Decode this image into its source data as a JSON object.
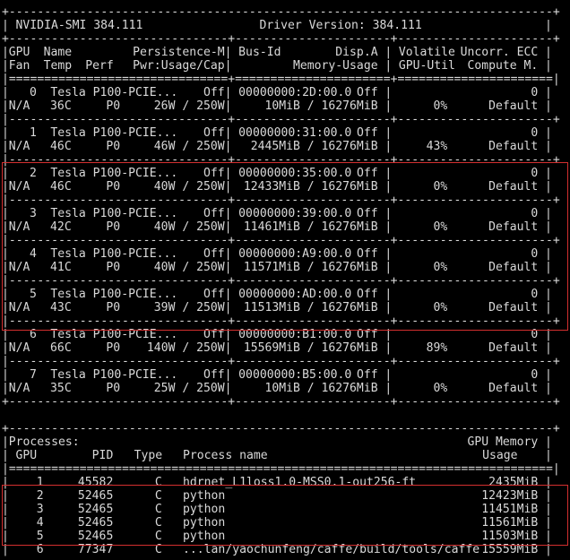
{
  "header": {
    "title": "NVIDIA-SMI 384.111",
    "driver_version": "Driver Version: 384.111"
  },
  "rules": {
    "dash_full": "+-----------------------------------------------------------------------------+",
    "dash_gpu": "+-------------------------------+----------------------+----------------------+",
    "double_gpu": "|===============================+======================+======================|",
    "double_full": "|=============================================================================|",
    "mid_gap": "|-------------------------------+----------------------+----------------------+"
  },
  "gpu_columns": {
    "r1": {
      "gpu": "GPU",
      "name": "Name",
      "persistence": "Persistence-M",
      "bus_id": "Bus-Id",
      "disp_a": "Disp.A",
      "volatile": "Volatile",
      "ecc": "Uncorr. ECC"
    },
    "r2": {
      "fan": "Fan",
      "temp": "Temp",
      "perf": "Perf",
      "pwr": "Pwr:Usage/Cap",
      "memory_usage": "Memory-Usage",
      "gpu_util": "GPU-Util",
      "compute": "Compute M."
    }
  },
  "gpus": [
    {
      "index": "0",
      "name": "Tesla P100-PCIE...",
      "persistence": "Off",
      "bus_id": "00000000:2D:00.0",
      "disp": "Off",
      "ecc": "0",
      "fan": "N/A",
      "temp": "36C",
      "perf": "P0",
      "power": "26W / 250W",
      "memory": "10MiB / 16276MiB",
      "util": "0%",
      "compute": "Default"
    },
    {
      "index": "1",
      "name": "Tesla P100-PCIE...",
      "persistence": "Off",
      "bus_id": "00000000:31:00.0",
      "disp": "Off",
      "ecc": "0",
      "fan": "N/A",
      "temp": "46C",
      "perf": "P0",
      "power": "46W / 250W",
      "memory": "2445MiB / 16276MiB",
      "util": "43%",
      "compute": "Default"
    },
    {
      "index": "2",
      "name": "Tesla P100-PCIE...",
      "persistence": "Off",
      "bus_id": "00000000:35:00.0",
      "disp": "Off",
      "ecc": "0",
      "fan": "N/A",
      "temp": "46C",
      "perf": "P0",
      "power": "40W / 250W",
      "memory": "12433MiB / 16276MiB",
      "util": "0%",
      "compute": "Default"
    },
    {
      "index": "3",
      "name": "Tesla P100-PCIE...",
      "persistence": "Off",
      "bus_id": "00000000:39:00.0",
      "disp": "Off",
      "ecc": "0",
      "fan": "N/A",
      "temp": "42C",
      "perf": "P0",
      "power": "40W / 250W",
      "memory": "11461MiB / 16276MiB",
      "util": "0%",
      "compute": "Default"
    },
    {
      "index": "4",
      "name": "Tesla P100-PCIE...",
      "persistence": "Off",
      "bus_id": "00000000:A9:00.0",
      "disp": "Off",
      "ecc": "0",
      "fan": "N/A",
      "temp": "41C",
      "perf": "P0",
      "power": "40W / 250W",
      "memory": "11571MiB / 16276MiB",
      "util": "0%",
      "compute": "Default"
    },
    {
      "index": "5",
      "name": "Tesla P100-PCIE...",
      "persistence": "Off",
      "bus_id": "00000000:AD:00.0",
      "disp": "Off",
      "ecc": "0",
      "fan": "N/A",
      "temp": "43C",
      "perf": "P0",
      "power": "39W / 250W",
      "memory": "11513MiB / 16276MiB",
      "util": "0%",
      "compute": "Default"
    },
    {
      "index": "6",
      "name": "Tesla P100-PCIE...",
      "persistence": "Off",
      "bus_id": "00000000:B1:00.0",
      "disp": "Off",
      "ecc": "0",
      "fan": "N/A",
      "temp": "66C",
      "perf": "P0",
      "power": "140W / 250W",
      "memory": "15569MiB / 16276MiB",
      "util": "89%",
      "compute": "Default"
    },
    {
      "index": "7",
      "name": "Tesla P100-PCIE...",
      "persistence": "Off",
      "bus_id": "00000000:B5:00.0",
      "disp": "Off",
      "ecc": "0",
      "fan": "N/A",
      "temp": "35C",
      "perf": "P0",
      "power": "25W / 250W",
      "memory": "10MiB / 16276MiB",
      "util": "0%",
      "compute": "Default"
    }
  ],
  "processes": {
    "heading": "Processes:",
    "gpu_memory_1": "GPU Memory",
    "columns": {
      "gpu": "GPU",
      "pid": "PID",
      "type": "Type",
      "name": "Process name",
      "usage": "Usage"
    },
    "rows": [
      {
        "gpu": "1",
        "pid": "45582",
        "type": "C",
        "name": "hdrnet_L1loss1.0-MSS0.1-out256-ft",
        "memory": "2435MiB"
      },
      {
        "gpu": "2",
        "pid": "52465",
        "type": "C",
        "name": "python",
        "memory": "12423MiB"
      },
      {
        "gpu": "3",
        "pid": "52465",
        "type": "C",
        "name": "python",
        "memory": "11451MiB"
      },
      {
        "gpu": "4",
        "pid": "52465",
        "type": "C",
        "name": "python",
        "memory": "11561MiB"
      },
      {
        "gpu": "5",
        "pid": "52465",
        "type": "C",
        "name": "python",
        "memory": "11503MiB"
      },
      {
        "gpu": "6",
        "pid": "77347",
        "type": "C",
        "name": "...lan/yaochunfeng/caffe/build/tools/caffe",
        "memory": "15559MiB"
      }
    ]
  },
  "highlight_color": "#d32f2f",
  "text_color": "#d9d9d9",
  "background": "#000000"
}
